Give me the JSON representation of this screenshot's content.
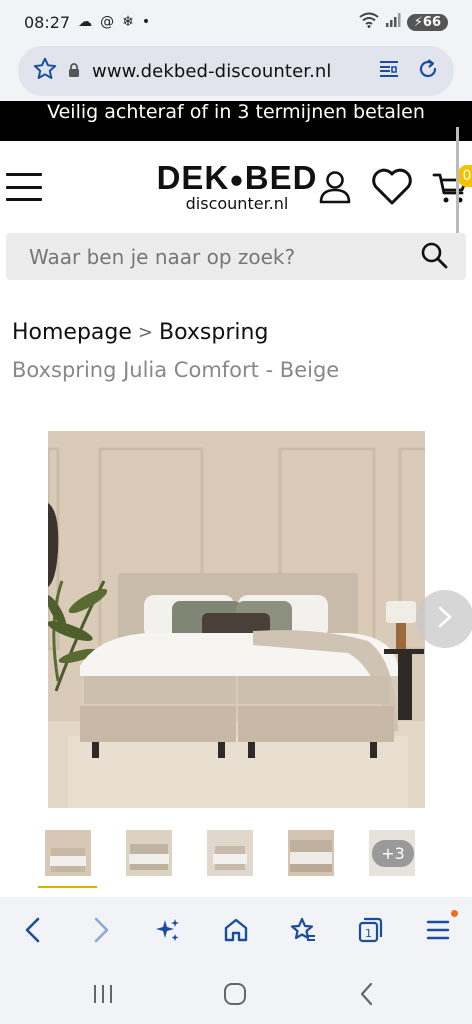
{
  "status": {
    "time": "08:27",
    "battery": "66"
  },
  "browser": {
    "url": "www.dekbed-discounter.nl"
  },
  "promo": {
    "text": "Veilig achteraf of in 3 termijnen betalen"
  },
  "header": {
    "logo_main_left": "DEK",
    "logo_main_right": "BED",
    "logo_sub": "discounter.nl",
    "cart_count": "0"
  },
  "search": {
    "placeholder": "Waar ben je naar op zoek?"
  },
  "breadcrumb": {
    "home": "Homepage",
    "separator": ">",
    "category": "Boxspring"
  },
  "product": {
    "title": "Boxspring Julia Comfort - Beige",
    "more_images": "+3"
  },
  "colors": {
    "accent": "#f4c300",
    "browser_blue": "#1a4e9c",
    "wall": "#d9cbb8",
    "bed_fabric": "#cdbfae"
  },
  "icons": {
    "toolbar": [
      "back-icon",
      "forward-icon",
      "sparkle-icon",
      "home-icon",
      "favorites-icon",
      "tabs-icon",
      "menu-icon"
    ],
    "tabs_count": "1"
  }
}
